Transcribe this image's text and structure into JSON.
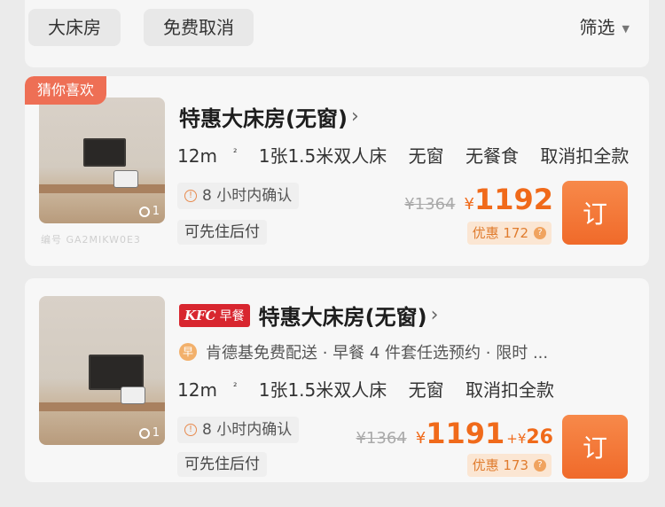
{
  "filters": {
    "chips": [
      "大床房",
      "免费取消"
    ],
    "filter_label": "筛选"
  },
  "colors": {
    "accent_orange": "#f06a1a",
    "tag_red": "#ee6f55",
    "kfc_red": "#d8262f",
    "book_button": "#f06a2a"
  },
  "rooms": [
    {
      "tag": "猜你喜欢",
      "title": "特惠大床房(无窗)",
      "arrow": "›",
      "photo_count": "1",
      "watermark": "编号 GA2MIKW0E3",
      "facts": {
        "area": "12m",
        "area_unit": "²",
        "bed": "1张1.5米双人床",
        "window": "无窗",
        "meal": "无餐食",
        "cancel": "取消扣全款"
      },
      "confirm": "8 小时内确认",
      "pay_later": "可先住后付",
      "old_price": "¥1364",
      "currency": "¥",
      "price": "1192",
      "discount": "优惠 172",
      "book_label": "订",
      "icons": {
        "confirm": "clock-alert-icon",
        "photo": "camera-icon",
        "discount": "info-icon"
      }
    },
    {
      "kfc_badge": {
        "logo": "KFC",
        "meal": "早餐"
      },
      "title": "特惠大床房(无窗)",
      "arrow": "›",
      "photo_count": "1",
      "promo_icon": "早",
      "promo": "肯德基免费配送 · 早餐 4 件套任选预约 · 限时 ...",
      "facts": {
        "area": "12m",
        "area_unit": "²",
        "bed": "1张1.5米双人床",
        "window": "无窗",
        "cancel": "取消扣全款"
      },
      "confirm": "8 小时内确认",
      "pay_later": "可先住后付",
      "old_price": "¥1364",
      "currency": "¥",
      "price": "1191",
      "addon_prefix": "+¥",
      "addon_price": "26",
      "discount": "优惠 173",
      "book_label": "订",
      "icons": {
        "confirm": "clock-alert-icon",
        "photo": "camera-icon",
        "discount": "info-icon"
      }
    }
  ]
}
